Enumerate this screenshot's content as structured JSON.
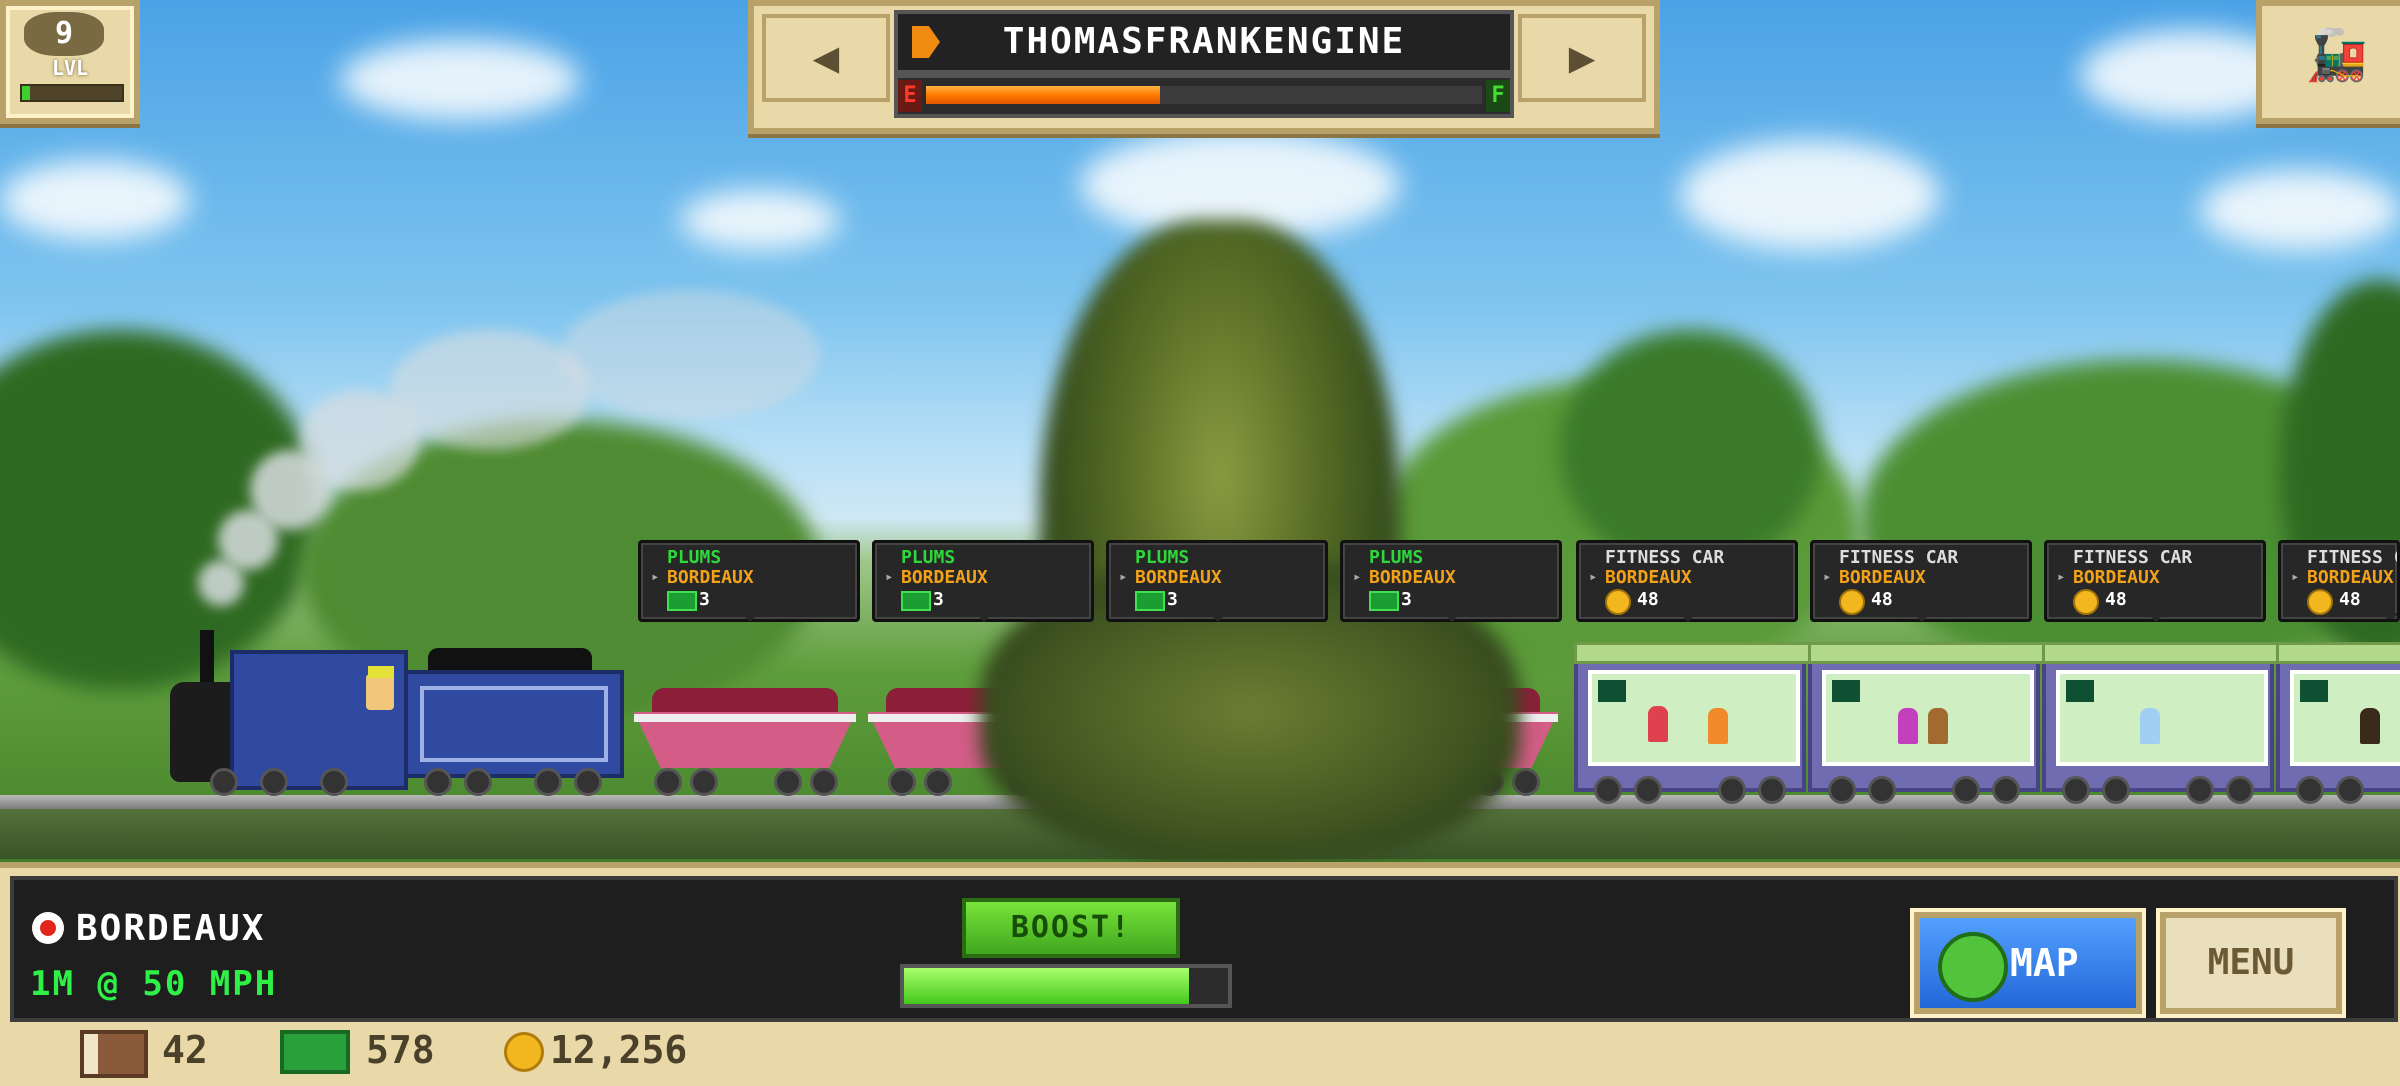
{
  "level": {
    "number": "9",
    "label": "LVL",
    "progress": 0.08
  },
  "engine": {
    "name": "THOMASFRANKENGINE",
    "fuel_empty_label": "E",
    "fuel_full_label": "F",
    "fuel_level": 0.42
  },
  "cars": [
    {
      "type": "cargo",
      "title": "PLUMS",
      "dest": "BORDEAUX",
      "count": "3"
    },
    {
      "type": "cargo",
      "title": "PLUMS",
      "dest": "BORDEAUX",
      "count": "3"
    },
    {
      "type": "cargo",
      "title": "PLUMS",
      "dest": "BORDEAUX",
      "count": "3"
    },
    {
      "type": "cargo",
      "title": "PLUMS",
      "dest": "BORDEAUX",
      "count": "3"
    },
    {
      "type": "passenger",
      "title": "FITNESS CAR",
      "dest": "BORDEAUX",
      "count": "48"
    },
    {
      "type": "passenger",
      "title": "FITNESS CAR",
      "dest": "BORDEAUX",
      "count": "48"
    },
    {
      "type": "passenger",
      "title": "FITNESS CAR",
      "dest": "BORDEAUX",
      "count": "48"
    },
    {
      "type": "passenger",
      "title": "FITNESS CAR",
      "dest": "BORDEAUX",
      "count": "48"
    }
  ],
  "status": {
    "station": "BORDEAUX",
    "speed": "1M @ 50 MPH"
  },
  "boost": {
    "label": "BOOST!",
    "level": 0.88
  },
  "buttons": {
    "map": "MAP",
    "menu": "MENU"
  },
  "resources": {
    "crates": "42",
    "cash": "578",
    "coins": "12,256"
  },
  "colors": {
    "fuel": "#ff7a00",
    "cargo_text": "#2fd83a",
    "dest_text": "#f2a21a",
    "boost": "#44c81c"
  },
  "icons": {
    "prev": "◀",
    "next": "▶",
    "train": "🚂"
  }
}
